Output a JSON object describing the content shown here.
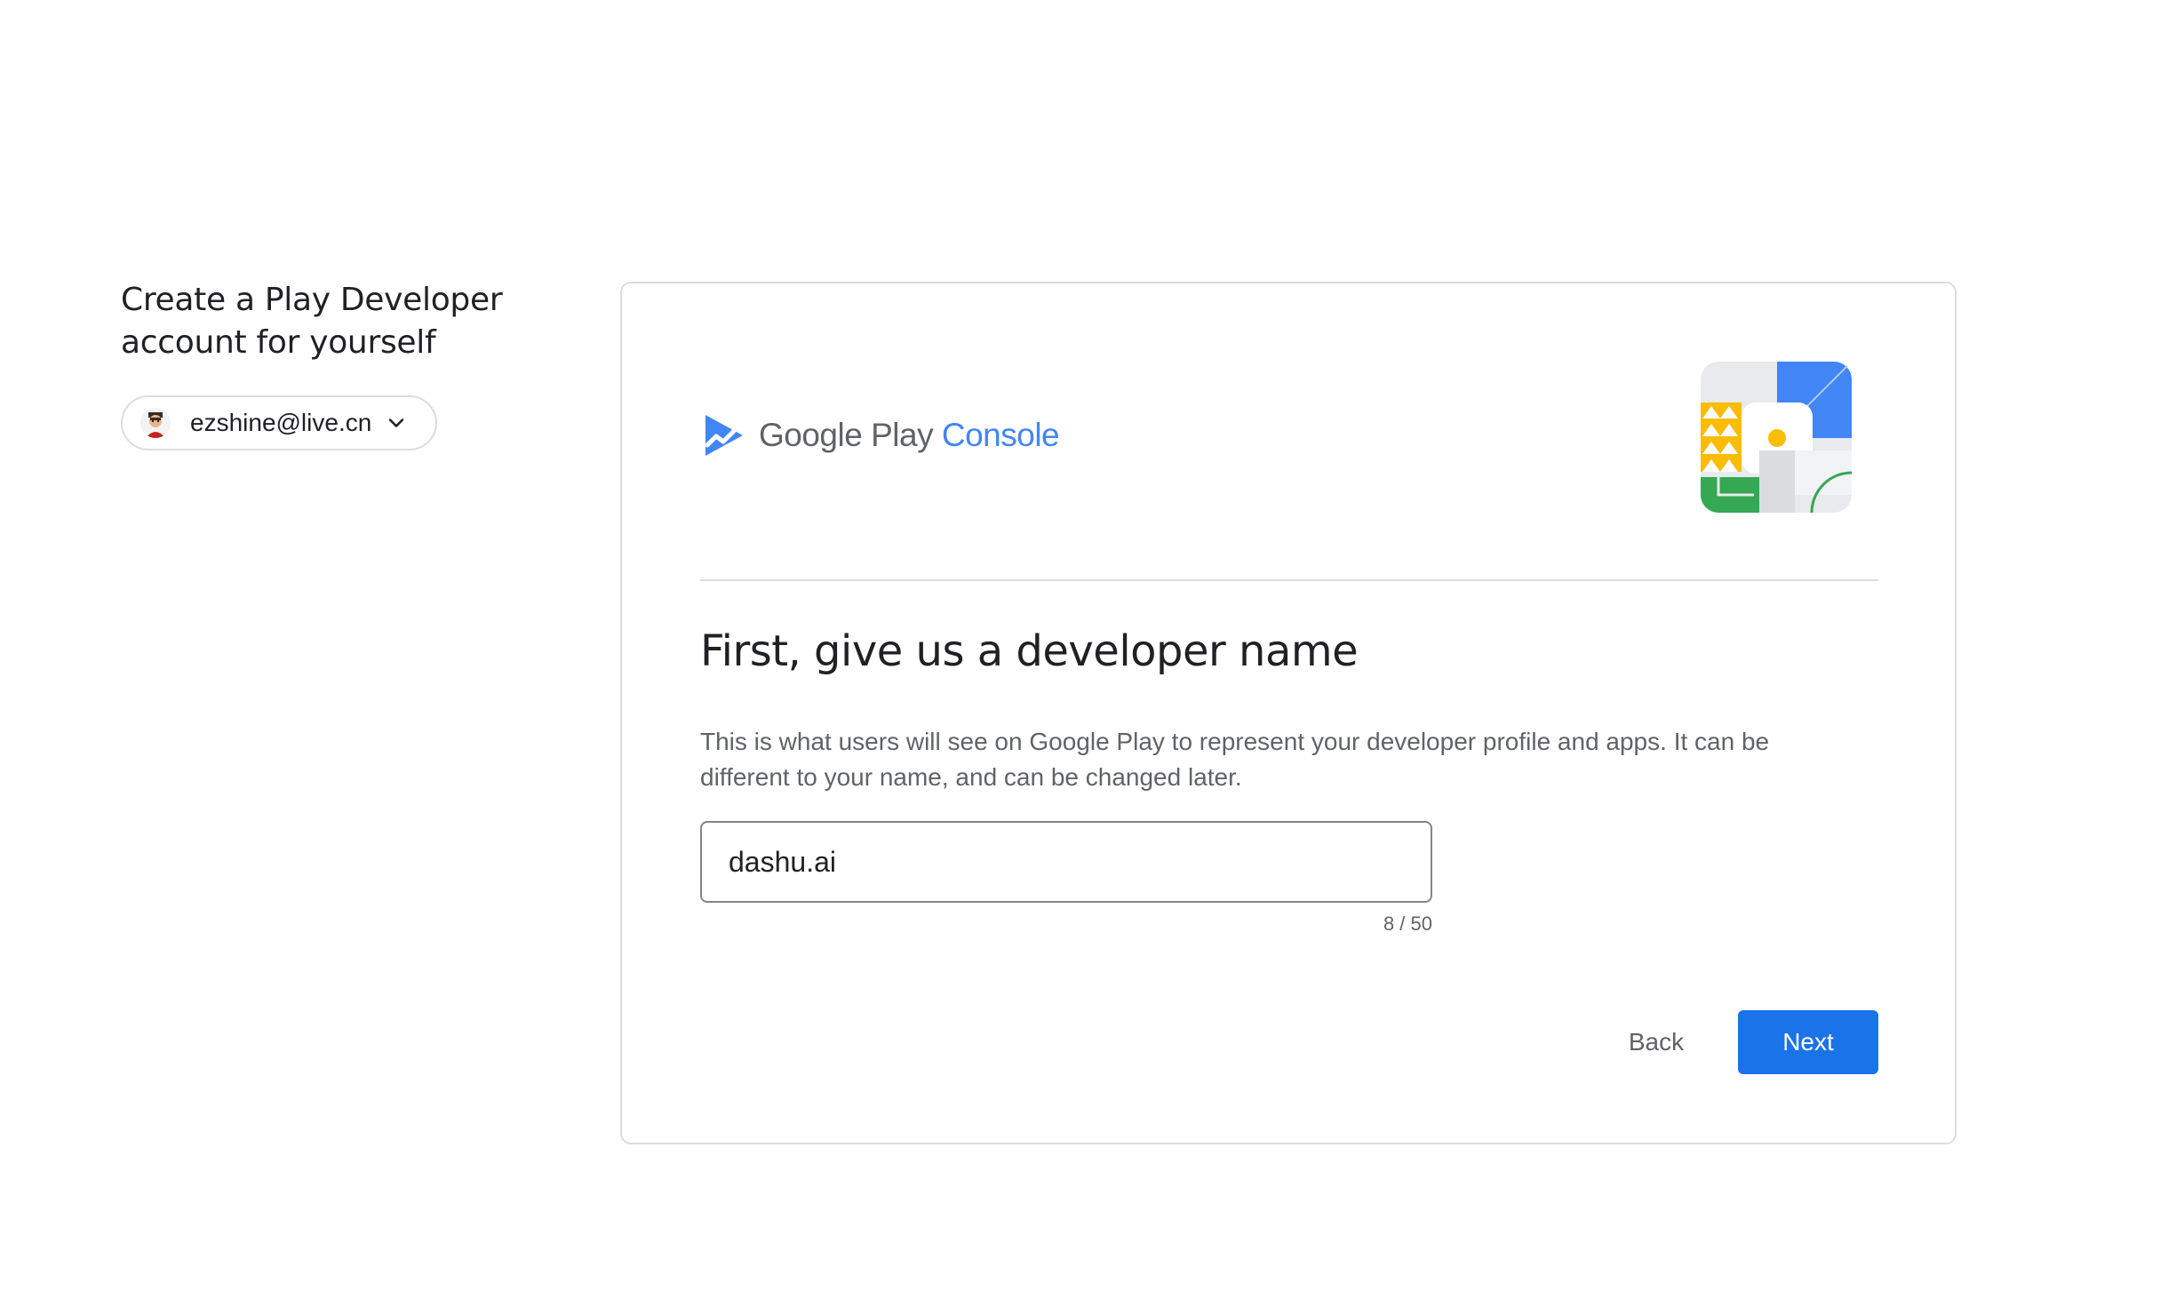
{
  "sidebar": {
    "title": "Create a Play Developer account for yourself",
    "account_email": "ezshine@live.cn"
  },
  "card": {
    "logo_brand": "Google Play",
    "logo_product": "Console",
    "heading": "First, give us a developer name",
    "description": "This is what users will see on Google Play to represent your developer profile and apps. It can be different to your name, and can be changed later.",
    "developer_name_value": "dashu.ai",
    "char_counter": "8 / 50",
    "back_label": "Back",
    "next_label": "Next"
  },
  "icons": {
    "account_avatar": "avatar-icon",
    "dropdown": "chevron-down-icon",
    "logo": "play-console-logo-icon",
    "illustration": "developer-illustration"
  },
  "colors": {
    "primary": "#1a73e8",
    "console_blue": "#4285f4",
    "border": "#dadce0",
    "text_secondary": "#5f6368"
  }
}
